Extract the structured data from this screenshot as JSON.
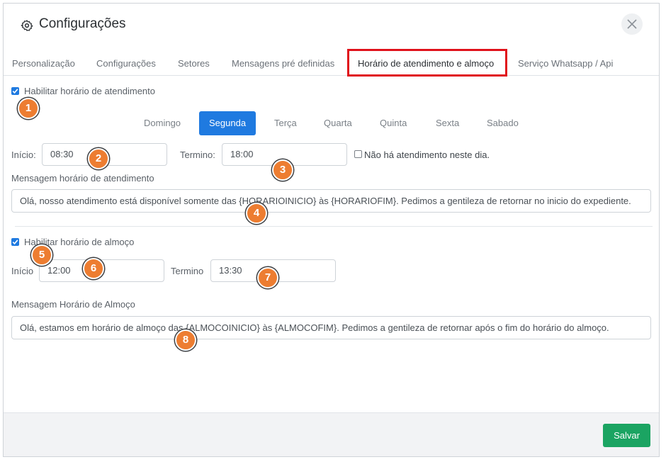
{
  "header": {
    "title": "Configurações"
  },
  "tabs": [
    {
      "label": "Personalização"
    },
    {
      "label": "Configurações"
    },
    {
      "label": "Setores"
    },
    {
      "label": "Mensagens pré definidas"
    },
    {
      "label": "Horário de atendimento e almoço"
    },
    {
      "label": "Serviço Whatsapp / Api"
    }
  ],
  "atendimento": {
    "enable_label": "Habilitar horário de atendimento",
    "enabled": true,
    "days": [
      "Domingo",
      "Segunda",
      "Terça",
      "Quarta",
      "Quinta",
      "Sexta",
      "Sabado"
    ],
    "selected_day": "Segunda",
    "start_label": "Início:",
    "start_value": "08:30",
    "end_label": "Termino:",
    "end_value": "18:00",
    "no_service_label": "Não há atendimento neste dia.",
    "no_service_checked": false,
    "message_label": "Mensagem horário de atendimento",
    "message_value": "Olá, nosso atendimento está disponível somente das {HORARIOINICIO} às {HORARIOFIM}. Pedimos a gentileza de retornar  no inicio do expediente."
  },
  "almoco": {
    "enable_label": "Habilitar horário de almoço",
    "enabled": true,
    "start_label": "Início",
    "start_value": "12:00",
    "end_label": "Termino",
    "end_value": "13:30",
    "message_label": "Mensagem Horário de Almoço",
    "message_value": "Olá, estamos em horário de almoço das {ALMOCOINICIO} às {ALMOCOFIM}. Pedimos a gentileza de retornar após o fim do horário do almoço."
  },
  "footer": {
    "save_label": "Salvar"
  },
  "badges": [
    "1",
    "2",
    "3",
    "4",
    "5",
    "6",
    "7",
    "8"
  ],
  "colors": {
    "primary": "#1f7ae0",
    "success": "#1ba462",
    "highlight": "#e0121b",
    "badge": "#ed7d31"
  }
}
